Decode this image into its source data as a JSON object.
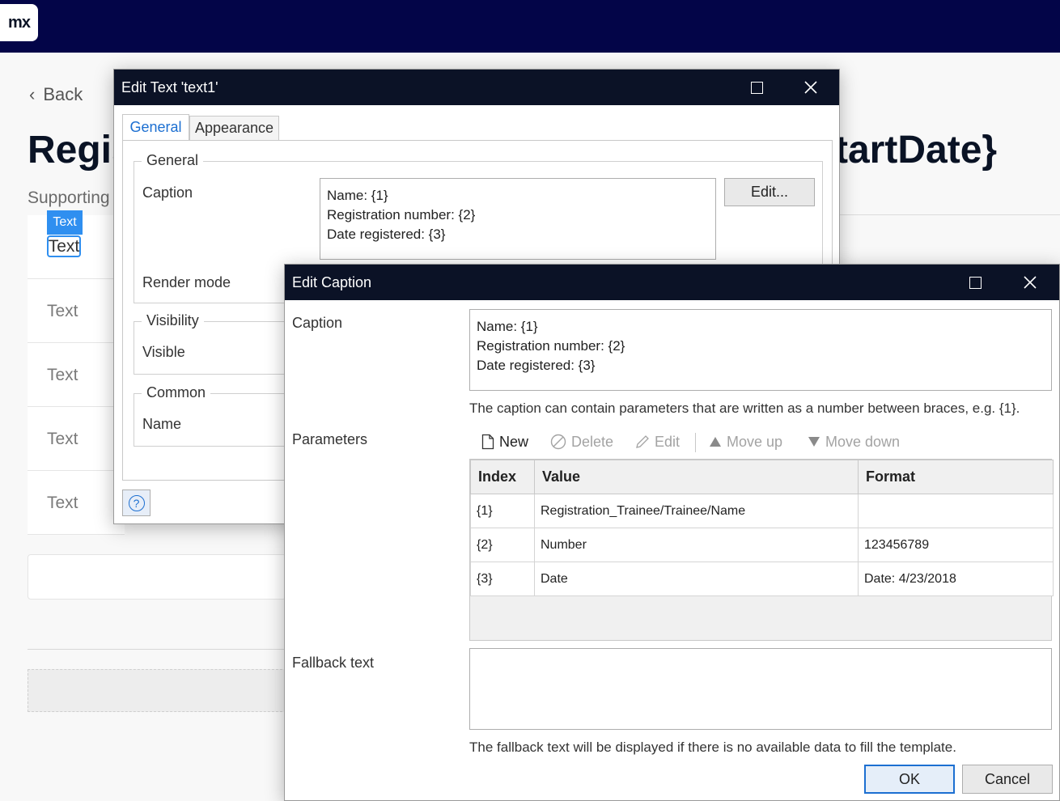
{
  "app": {
    "logo": "mx"
  },
  "page": {
    "back_label": "Back",
    "title_left": "Regis",
    "title_right": "tartDate}",
    "supporting": "Supporting",
    "selected_tag": "Text",
    "selected_text": "Text",
    "list_items": [
      "Text",
      "Text",
      "Text",
      "Text"
    ]
  },
  "edit_text_dialog": {
    "title": "Edit Text 'text1'",
    "tabs": [
      {
        "label": "General",
        "active": true
      },
      {
        "label": "Appearance",
        "active": false
      }
    ],
    "groups": {
      "general": {
        "legend": "General",
        "caption_label": "Caption",
        "caption_lines": [
          "Name: {1}",
          "Registration number: {2}",
          "Date registered: {3}"
        ],
        "edit_button": "Edit...",
        "render_mode_label": "Render mode"
      },
      "visibility": {
        "legend": "Visibility",
        "visible_label": "Visible"
      },
      "common": {
        "legend": "Common",
        "name_label": "Name"
      }
    },
    "help_icon": "question-circle-icon"
  },
  "edit_caption_dialog": {
    "title": "Edit Caption",
    "caption_label": "Caption",
    "caption_lines": [
      "Name: {1}",
      "Registration number: {2}",
      "Date registered: {3}"
    ],
    "caption_hint": "The caption can contain parameters that are written as a number between braces, e.g. {1}.",
    "parameters_label": "Parameters",
    "toolbar": {
      "new": "New",
      "delete": "Delete",
      "edit": "Edit",
      "move_up": "Move up",
      "move_down": "Move down"
    },
    "table": {
      "headers": [
        "Index",
        "Value",
        "Format"
      ],
      "rows": [
        [
          "{1}",
          "Registration_Trainee/Trainee/Name",
          ""
        ],
        [
          "{2}",
          "Number",
          "123456789"
        ],
        [
          "{3}",
          "Date",
          "Date: 4/23/2018"
        ]
      ]
    },
    "fallback_label": "Fallback text",
    "fallback_value": "",
    "fallback_hint": "The fallback text will be displayed if there is no available data to fill the template.",
    "ok_label": "OK",
    "cancel_label": "Cancel"
  },
  "colors": {
    "topbar": "#030548",
    "titlebar": "#0b1226",
    "accent": "#1c6fd1",
    "selection": "#2f8ff0"
  }
}
